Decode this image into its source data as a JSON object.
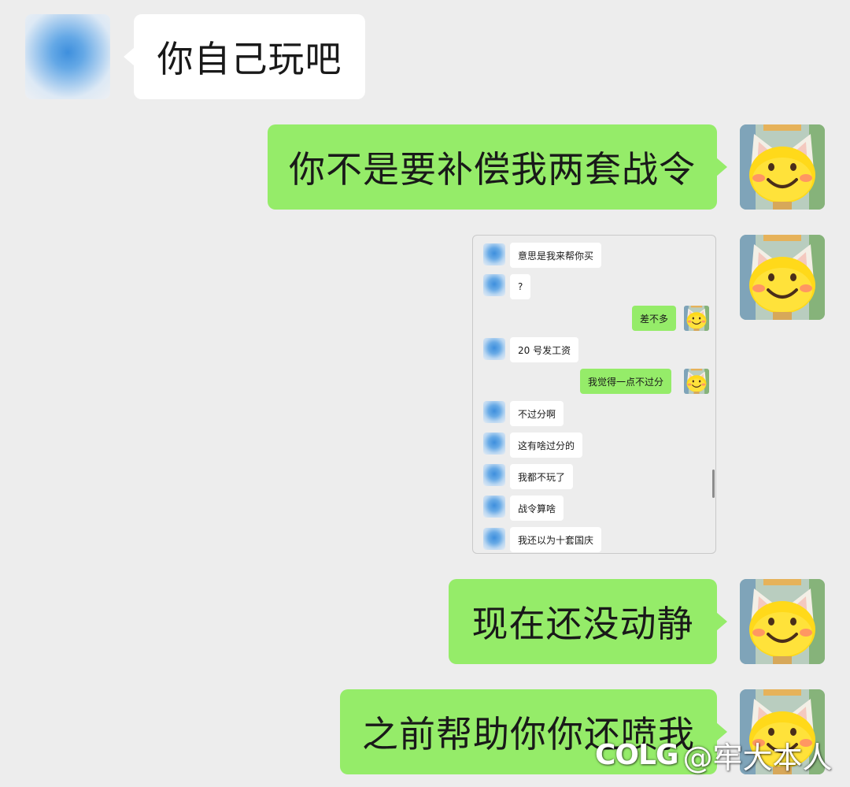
{
  "colors": {
    "background": "#ededed",
    "bubble_sent": "#95ec69",
    "bubble_received": "#ffffff",
    "text": "#191919"
  },
  "icons": {
    "other_avatar": "blurred-avatar",
    "self_avatar": "yellow-cat-face-avatar"
  },
  "messages": [
    {
      "side": "left",
      "type": "text",
      "text": "你自己玩吧"
    },
    {
      "side": "right",
      "type": "text",
      "text": "你不是要补偿我两套战令"
    },
    {
      "side": "right",
      "type": "image",
      "description_key": "screenshot"
    },
    {
      "side": "right",
      "type": "text",
      "text": "现在还没动静"
    },
    {
      "side": "right",
      "type": "text",
      "text": "之前帮助你你还喷我"
    }
  ],
  "screenshot": {
    "messages": [
      {
        "side": "left",
        "text": "意思是我来帮你买"
      },
      {
        "side": "left",
        "text": "?"
      },
      {
        "side": "right",
        "text": "差不多"
      },
      {
        "side": "left",
        "text": "20 号发工资"
      },
      {
        "side": "right",
        "text": "我觉得一点不过分"
      },
      {
        "side": "left",
        "text": "不过分啊"
      },
      {
        "side": "left",
        "text": "这有啥过分的"
      },
      {
        "side": "left",
        "text": "我都不玩了"
      },
      {
        "side": "left",
        "text": "战令算啥"
      },
      {
        "side": "left",
        "text": "我还以为十套国庆"
      }
    ]
  },
  "watermark": {
    "logo": "COLG",
    "handle": "@牢大本人"
  }
}
